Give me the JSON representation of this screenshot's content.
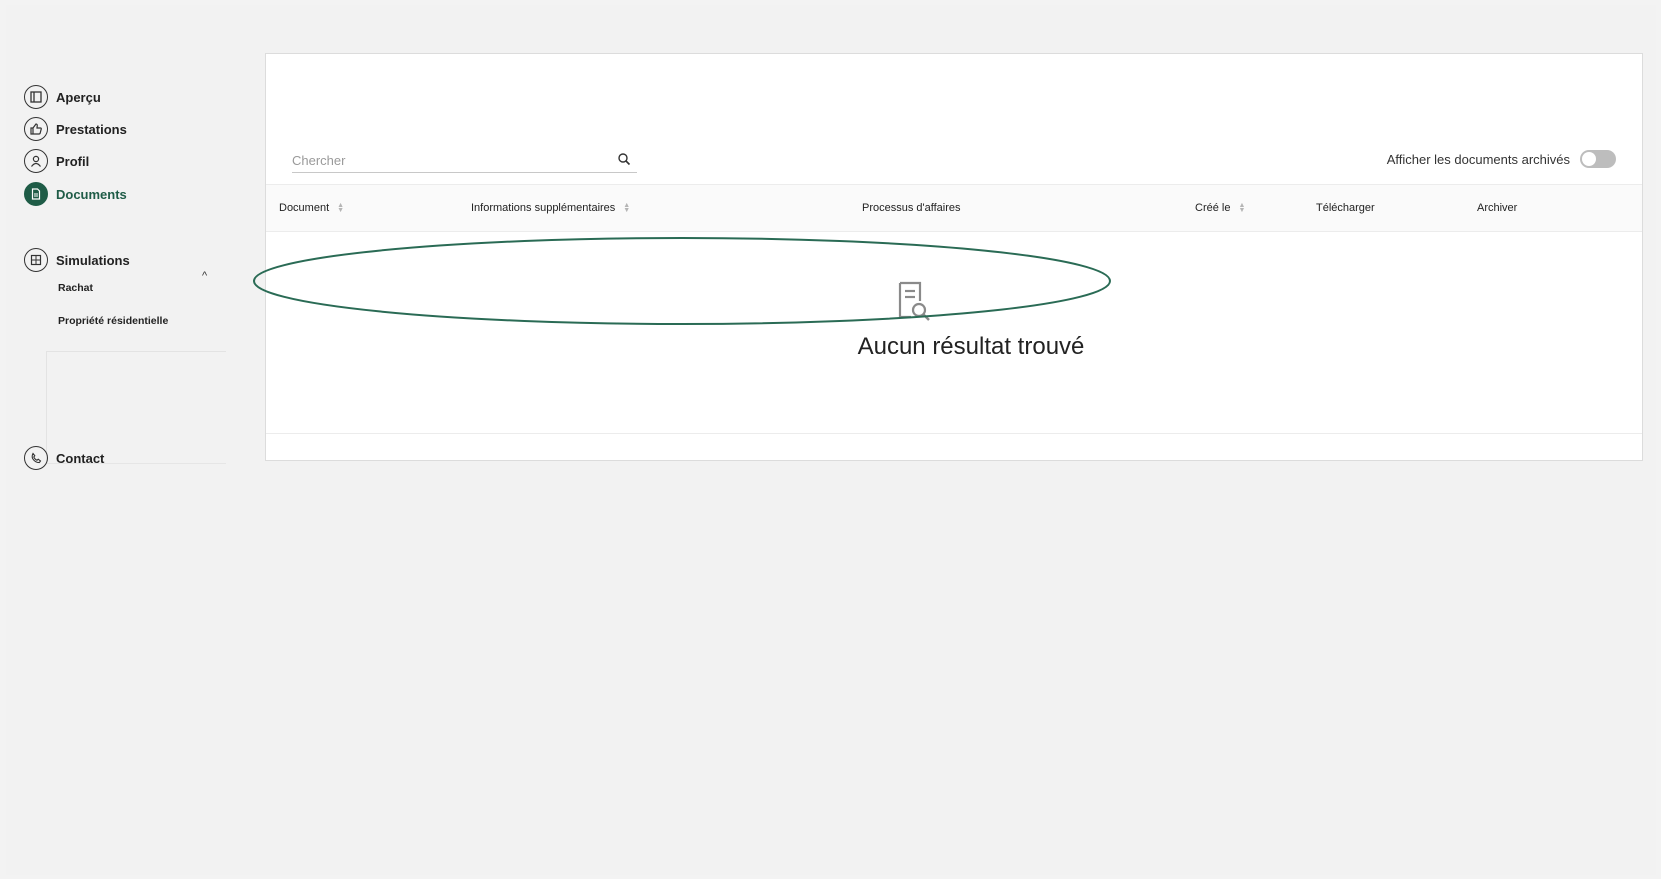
{
  "colors": {
    "accent": "#1f5c47",
    "annotation": "#2a6b55"
  },
  "sidebar": {
    "items": [
      {
        "label": "Aperçu",
        "icon": "layout-icon"
      },
      {
        "label": "Prestations",
        "icon": "thumbs-up-icon"
      },
      {
        "label": "Profil",
        "icon": "user-icon"
      },
      {
        "label": "Documents",
        "icon": "document-icon",
        "active": true
      }
    ],
    "simulations": {
      "label": "Simulations",
      "icon": "calculator-icon",
      "expanded": true,
      "children": [
        "Rachat",
        "Propriété résidentielle"
      ]
    },
    "contact": {
      "label": "Contact",
      "icon": "phone-icon"
    }
  },
  "search": {
    "placeholder": "Chercher"
  },
  "archive_toggle": {
    "label": "Afficher les documents archivés",
    "on": false
  },
  "table": {
    "columns": [
      {
        "label": "Document",
        "sortable": true
      },
      {
        "label": "Informations supplémentaires",
        "sortable": true
      },
      {
        "label": "Processus d'affaires",
        "sortable": false
      },
      {
        "label": "Créé le",
        "sortable": true
      },
      {
        "label": "Télécharger",
        "sortable": false
      },
      {
        "label": "Archiver",
        "sortable": false
      }
    ],
    "empty_message": "Aucun résultat trouvé"
  }
}
